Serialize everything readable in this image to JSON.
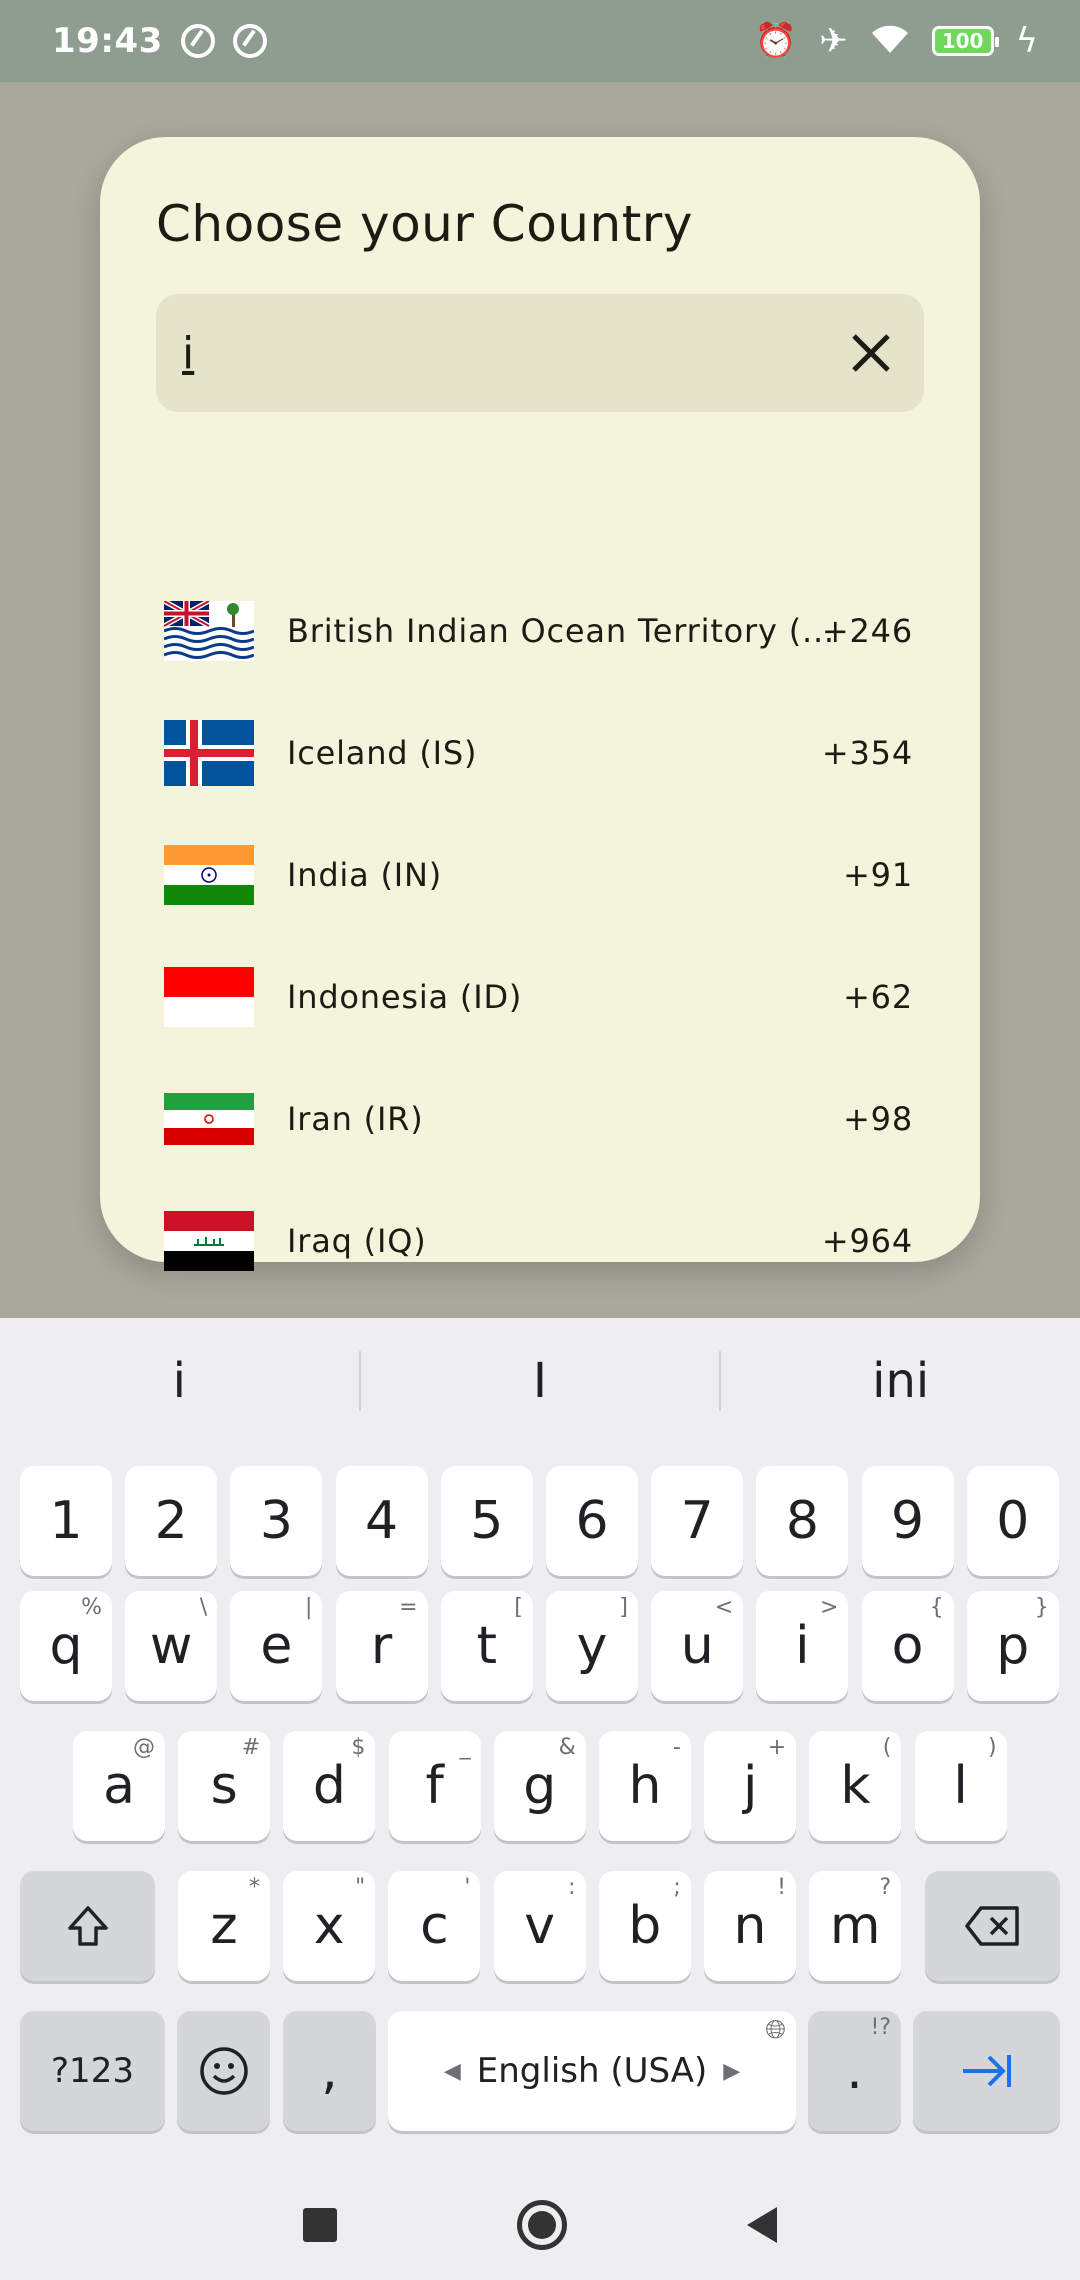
{
  "status_bar": {
    "time": "19:43",
    "battery": "100",
    "icons": [
      "sync-icon",
      "sync-icon",
      "alarm-icon",
      "airplane-icon",
      "wifi-icon",
      "battery-icon",
      "charging-icon"
    ]
  },
  "dialog": {
    "title": "Choose your Country",
    "search_value": "i",
    "clear_icon": "close-icon"
  },
  "countries": [
    {
      "name": "British Indian Ocean Territory (...",
      "code": "+246",
      "flag": "io"
    },
    {
      "name": "Iceland (IS)",
      "code": "+354",
      "flag": "is"
    },
    {
      "name": "India (IN)",
      "code": "+91",
      "flag": "in"
    },
    {
      "name": "Indonesia (ID)",
      "code": "+62",
      "flag": "id"
    },
    {
      "name": "Iran (IR)",
      "code": "+98",
      "flag": "ir"
    },
    {
      "name": "Iraq (IQ)",
      "code": "+964",
      "flag": "iq"
    }
  ],
  "keyboard": {
    "suggestions": [
      "i",
      "I",
      "ini"
    ],
    "number_row": [
      "1",
      "2",
      "3",
      "4",
      "5",
      "6",
      "7",
      "8",
      "9",
      "0"
    ],
    "row1": [
      {
        "k": "q",
        "h": "%"
      },
      {
        "k": "w",
        "h": "\\"
      },
      {
        "k": "e",
        "h": "|"
      },
      {
        "k": "r",
        "h": "="
      },
      {
        "k": "t",
        "h": "["
      },
      {
        "k": "y",
        "h": "]"
      },
      {
        "k": "u",
        "h": "<"
      },
      {
        "k": "i",
        "h": ">"
      },
      {
        "k": "o",
        "h": "{"
      },
      {
        "k": "p",
        "h": "}"
      }
    ],
    "row2": [
      {
        "k": "a",
        "h": "@"
      },
      {
        "k": "s",
        "h": "#"
      },
      {
        "k": "d",
        "h": "$"
      },
      {
        "k": "f",
        "h": "_"
      },
      {
        "k": "g",
        "h": "&"
      },
      {
        "k": "h",
        "h": "-"
      },
      {
        "k": "j",
        "h": "+"
      },
      {
        "k": "k",
        "h": "("
      },
      {
        "k": "l",
        "h": ")"
      }
    ],
    "row3": [
      {
        "k": "z",
        "h": "*"
      },
      {
        "k": "x",
        "h": "\""
      },
      {
        "k": "c",
        "h": "'"
      },
      {
        "k": "v",
        "h": ":"
      },
      {
        "k": "b",
        "h": ";"
      },
      {
        "k": "n",
        "h": "!"
      },
      {
        "k": "m",
        "h": "?"
      }
    ],
    "symbols_label": "?123",
    "comma": ",",
    "space_label": "English (USA)",
    "period": ".",
    "period_hint": "!?"
  }
}
